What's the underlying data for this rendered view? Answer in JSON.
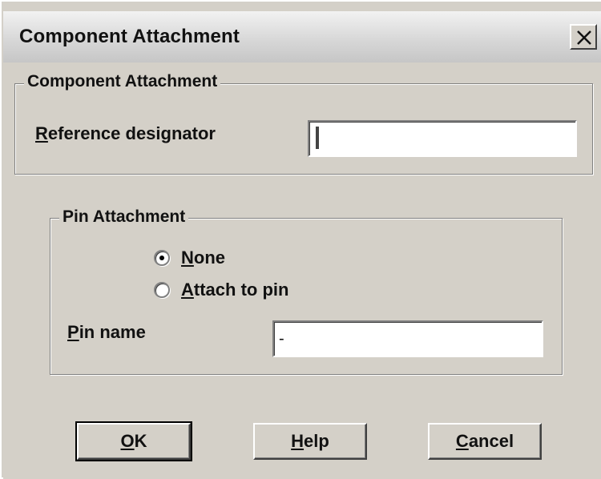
{
  "window": {
    "title": "Component Attachment",
    "close_icon": "close-icon"
  },
  "component_group": {
    "legend": "Component Attachment",
    "ref_label_accel": "R",
    "ref_label_rest": "eference designator",
    "ref_value": ""
  },
  "pin_group": {
    "legend": "Pin Attachment",
    "radio_none_accel": "N",
    "radio_none_rest": "one",
    "radio_attach_accel": "A",
    "radio_attach_rest": "ttach to pin",
    "selected": "None",
    "pin_label_accel": "P",
    "pin_label_rest": "in name",
    "pin_value": "-"
  },
  "buttons": {
    "ok_accel": "O",
    "ok_rest": "K",
    "help_accel": "H",
    "help_rest": "elp",
    "cancel_accel": "C",
    "cancel_rest": "ancel"
  }
}
